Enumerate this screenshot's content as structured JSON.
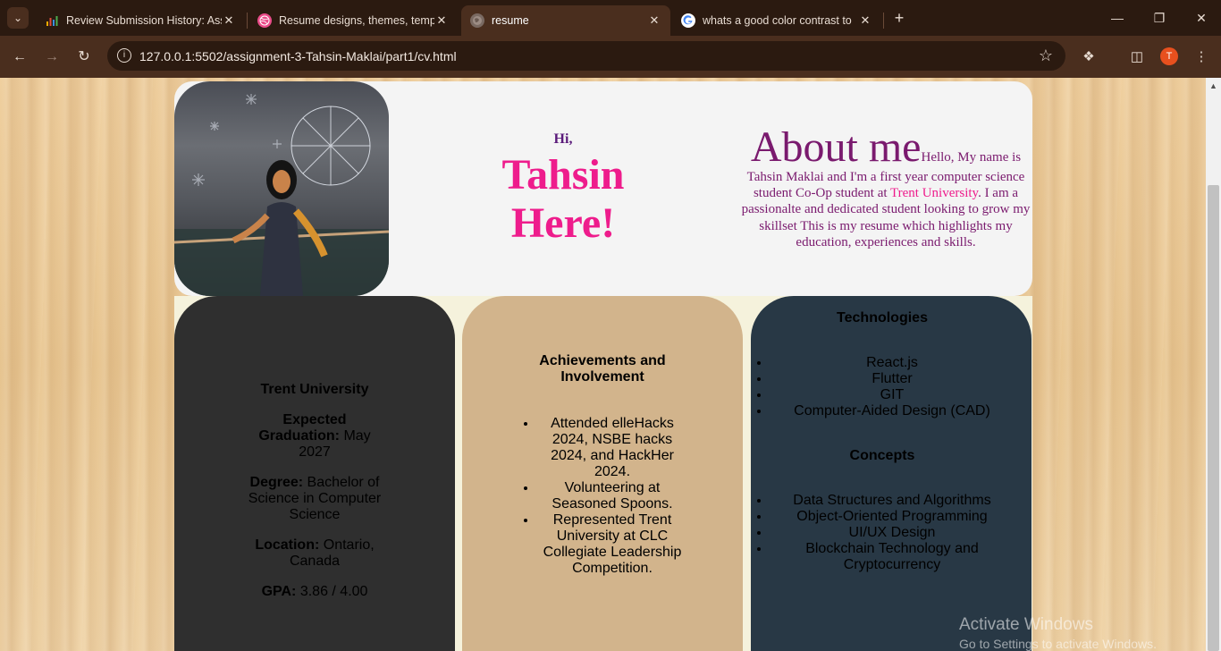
{
  "browser": {
    "tabs": [
      {
        "title": "Review Submission History: Assi",
        "icon": "bar-chart-icon",
        "active": false
      },
      {
        "title": "Resume designs, themes, templ",
        "icon": "dribbble-icon",
        "active": false
      },
      {
        "title": "resume",
        "icon": "globe-icon",
        "active": true
      },
      {
        "title": "whats a good color contrast to",
        "icon": "google-icon",
        "active": false
      }
    ],
    "url": "127.0.0.1:5502/assignment-3-Tahsin-Maklai/part1/cv.html",
    "profile_initial": "T",
    "colors": {
      "frame": "#2b1a10",
      "toolbar": "#4a2e1e",
      "profile": "#e8501e"
    }
  },
  "page": {
    "greeting": "Hi,",
    "name_line1": "Tahsin",
    "name_line2": "Here!",
    "about": {
      "heading": "About me",
      "text_before": "Hello, My name is Tahsin Maklai and I'm a first year computer science student Co-Op student at ",
      "university_link": "Trent University",
      "text_after": ". I am a passionalte and dedicated student looking to grow my skillset This is my resume which highlights my education, experiences and skills."
    },
    "education": {
      "university": "Trent University",
      "graduation_label": "Expected Graduation:",
      "graduation_value": " May 2027",
      "degree_label": "Degree:",
      "degree_value": " Bachelor of Science in Computer Science",
      "location_label": "Location:",
      "location_value": " Ontario, Canada",
      "gpa_label": "GPA:",
      "gpa_value": " 3.86 / 4.00"
    },
    "achievements": {
      "heading": "Achievements and Involvement",
      "items": [
        "Attended elleHacks 2024, NSBE hacks 2024, and HackHer 2024.",
        "Volunteering at Seasoned Spoons.",
        "Represented Trent University at CLC Collegiate Leadership Competition."
      ]
    },
    "technologies": {
      "heading": "Technologies",
      "items": [
        "React.js",
        "Flutter",
        "GIT",
        "Computer-Aided Design (CAD)"
      ]
    },
    "concepts": {
      "heading": "Concepts",
      "items": [
        "Data Structures and Algorithms",
        "Object-Oriented Programming",
        "UI/UX Design",
        "Blockchain Technology and Cryptocurrency"
      ]
    },
    "colors": {
      "name": "#ee1c8c",
      "about": "#7a1a6e",
      "edu_card": "#2f2f2f",
      "ach_card": "#d2b48c",
      "tech_card": "#283845"
    }
  },
  "os": {
    "watermark_line1": "Activate Windows",
    "watermark_line2": "Go to Settings to activate Windows."
  }
}
